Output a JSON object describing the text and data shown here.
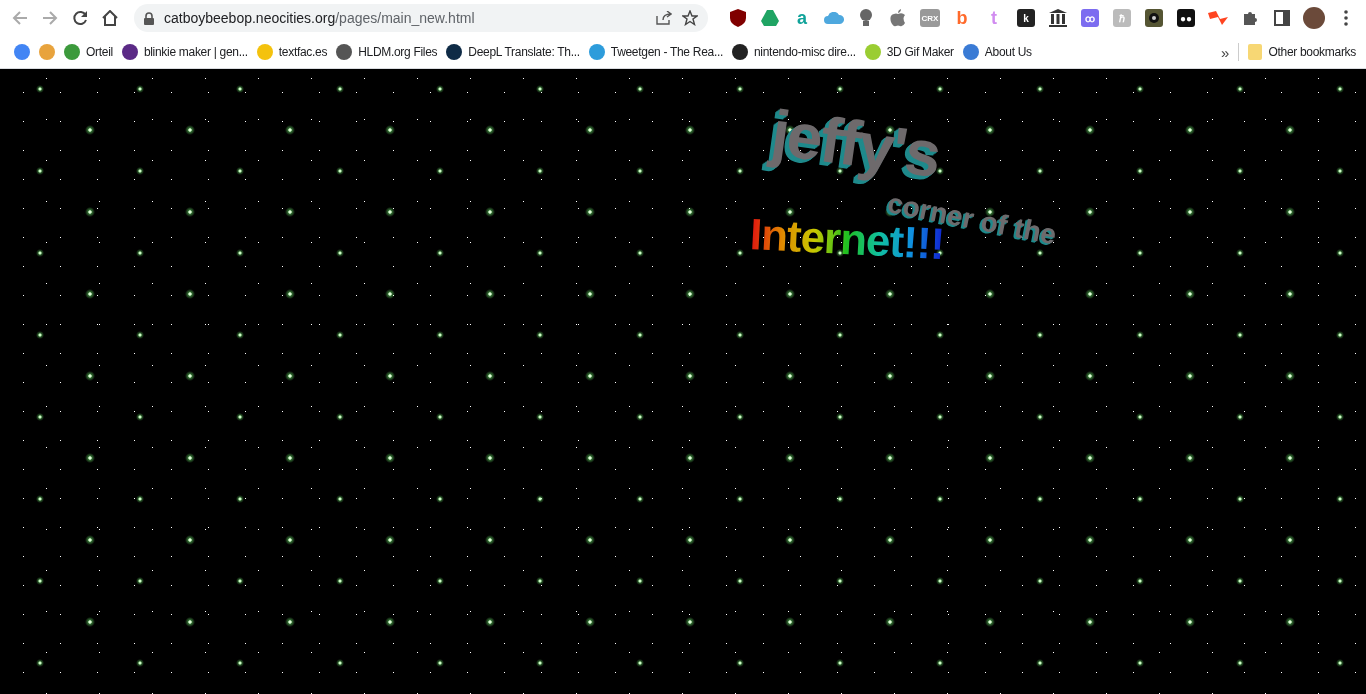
{
  "toolbar": {
    "url_host": "catboybeebop.neocities.org",
    "url_path": "/pages/main_new.html",
    "extensions": [
      {
        "kind": "shield",
        "color": "#800000"
      },
      {
        "kind": "triangle",
        "color": "#1fa463"
      },
      {
        "kind": "letter",
        "label": "a",
        "color": "#10a39a"
      },
      {
        "kind": "cloud",
        "color": "#4ea8de"
      },
      {
        "kind": "bulb",
        "color": "#666666"
      },
      {
        "kind": "apple",
        "color": "#777777"
      },
      {
        "kind": "tag",
        "label": "CRX",
        "color": "#999999"
      },
      {
        "kind": "letter",
        "label": "b",
        "color": "#ff6a2b"
      },
      {
        "kind": "letter",
        "label": "t",
        "color": "#d18cf0"
      },
      {
        "kind": "tag",
        "label": "k",
        "color": "#222222"
      },
      {
        "kind": "columns",
        "color": "#333333"
      },
      {
        "kind": "tag",
        "label": "ꝏ",
        "color": "#7c6cf0"
      },
      {
        "kind": "tag",
        "label": "ℏ",
        "color": "#bbbbbb"
      },
      {
        "kind": "eye",
        "color": "#555533"
      },
      {
        "kind": "tag",
        "label": "●●",
        "color": "#111111"
      },
      {
        "kind": "bolt",
        "color": "#ff4420"
      }
    ]
  },
  "bookmarks": [
    {
      "color": "#4285f4"
    },
    {
      "color": "#e8a33d"
    },
    {
      "label": "Orteil",
      "color": "#3c9a3c"
    },
    {
      "label": "blinkie maker | gen...",
      "color": "#5b2a86"
    },
    {
      "label": "textfac.es",
      "color": "#f4c20d"
    },
    {
      "label": "HLDM.org Files",
      "color": "#555555"
    },
    {
      "label": "DeepL Translate: Th...",
      "color": "#0f2b46"
    },
    {
      "label": "Tweetgen - The Rea...",
      "color": "#2d9cdb"
    },
    {
      "label": "nintendo-misc dire...",
      "color": "#222222"
    },
    {
      "label": "3D Gif Maker",
      "color": "#9acd32"
    },
    {
      "label": "About Us",
      "color": "#3a7bd5"
    }
  ],
  "more_bookmarks": "»",
  "other_bookmarks": "Other bookmarks",
  "page": {
    "title_line_1": "jeffy's",
    "title_line_2": "corner of the",
    "title_line_3": "Internet!!!"
  }
}
